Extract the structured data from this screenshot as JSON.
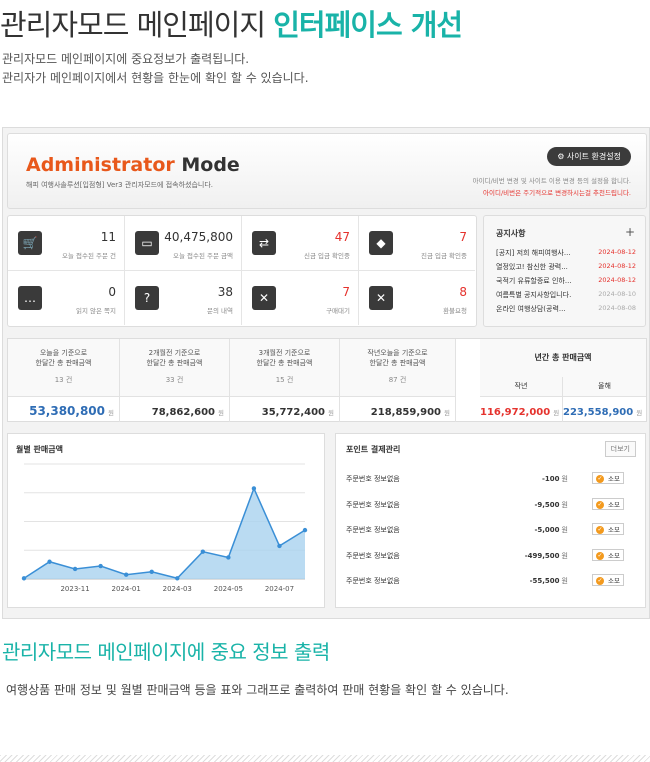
{
  "title": {
    "plain": "관리자모드 메인페이지 ",
    "highlight": "인터페이스 개선"
  },
  "intro": [
    "관리자모드 메인페이지에 중요정보가 출력됩니다.",
    "관리자가 메인페이지에서 현황을 한눈에 확인 할 수 있습니다."
  ],
  "header": {
    "logo_a": "Administrator",
    "logo_b": " Mode",
    "logo_sub": "해피 여행사솔루션[입점형] Ver3 관리자모드에 접속하셨습니다.",
    "site_settings": "⚙ 사이트 환경설정",
    "note1": "아이디/비번 변경 및 사이트 이용 변경 등의 설정을 합니다.",
    "note2": "아이디/비번은 주기적으로 변경하시는걸 추천드립니다."
  },
  "stats": [
    {
      "icon": "cart-icon",
      "glyph": "🛒",
      "value": "11",
      "label": "오늘 접수된 주문 건",
      "red": false
    },
    {
      "icon": "card-icon",
      "glyph": "▭",
      "value": "40,475,800",
      "label": "오늘 접수된 주문 금액",
      "red": false
    },
    {
      "icon": "deposit-icon",
      "glyph": "⇄",
      "value": "47",
      "label": "신금 입금 확인중",
      "red": true
    },
    {
      "icon": "cancel-icon",
      "glyph": "◆",
      "value": "7",
      "label": "진금 입금 확인중",
      "red": true
    },
    {
      "icon": "chat-icon",
      "glyph": "…",
      "value": "0",
      "label": "읽지 않은 쪽지",
      "red": false
    },
    {
      "icon": "question-icon",
      "glyph": "?",
      "value": "38",
      "label": "문의 내역",
      "red": false
    },
    {
      "icon": "cart-cancel-icon",
      "glyph": "✕",
      "value": "7",
      "label": "구매대기",
      "red": true
    },
    {
      "icon": "refund-icon",
      "glyph": "✕",
      "value": "8",
      "label": "환불요청",
      "red": true
    }
  ],
  "notice": {
    "title": "공지사항",
    "plus": "+",
    "items": [
      {
        "text": "[공지] 저희 해피여행사...",
        "date": "2024-08-12",
        "grey": false
      },
      {
        "text": "열정있고! 참신한 광력...",
        "date": "2024-08-12",
        "grey": false
      },
      {
        "text": "국적기 유류할증료 인하...",
        "date": "2024-08-12",
        "grey": false
      },
      {
        "text": "여름특별 공지사항입니다.",
        "date": "2024-08-10",
        "grey": true
      },
      {
        "text": "온라인 여행상담(공력...",
        "date": "2024-08-08",
        "grey": true
      }
    ]
  },
  "sales": {
    "columns": [
      {
        "p1": "오늘을 기준으로",
        "p2": "한달간 총 판매금액",
        "count": "13 건",
        "value": "53,380,800",
        "unit": "원"
      },
      {
        "p1": "2개월전 기준으로",
        "p2": "한달간 총 판매금액",
        "count": "33 건",
        "value": "78,862,600",
        "unit": "원"
      },
      {
        "p1": "3개월전 기준으로",
        "p2": "한달간 총 판매금액",
        "count": "15 건",
        "value": "35,772,400",
        "unit": "원"
      },
      {
        "p1": "작년오늘을 기준으로",
        "p2": "한달간 총 판매금액",
        "count": "87 건",
        "value": "218,859,900",
        "unit": "원"
      }
    ],
    "yearly_title": "년간 총 판매금액",
    "last_year_label": "작년",
    "this_year_label": "올해",
    "last_year_value": "116,972,000",
    "this_year_value": "223,558,900",
    "unit": "원"
  },
  "chart_data": {
    "type": "area",
    "title": "월별 판매금액",
    "x": [
      "2023-10",
      "2023-11",
      "2023-12",
      "2024-01",
      "2024-02",
      "2024-03",
      "2024-04",
      "2024-05",
      "2024-06",
      "2024-07",
      "2024-08"
    ],
    "tick_labels": [
      "2023-11",
      "2024-01",
      "2024-03",
      "2024-05",
      "2024-07"
    ],
    "values": [
      0.5,
      12,
      7,
      9,
      3,
      5,
      0.5,
      19,
      15,
      63,
      23,
      34
    ],
    "ylim": [
      0,
      80
    ],
    "grid": true,
    "colors": {
      "line": "#3a8fd6",
      "fill": "#a9d2ef"
    }
  },
  "points": {
    "title": "포인트 결제관리",
    "more": "더보기",
    "rows": [
      {
        "order": "주문번호 정보없음",
        "amount": "-100",
        "unit": "원",
        "btn": "소모"
      },
      {
        "order": "주문번호 정보없음",
        "amount": "-9,500",
        "unit": "원",
        "btn": "소모"
      },
      {
        "order": "주문번호 정보없음",
        "amount": "-5,000",
        "unit": "원",
        "btn": "소모"
      },
      {
        "order": "주문번호 정보없음",
        "amount": "-499,500",
        "unit": "원",
        "btn": "소모"
      },
      {
        "order": "주문번호 정보없음",
        "amount": "-55,500",
        "unit": "원",
        "btn": "소모"
      }
    ]
  },
  "section2": {
    "title": "관리자모드 메인페이지에 중요 정보 출력",
    "desc": "여행상품 판매 정보 및 월별 판매금액 등을 표와 그래프로 출력하여 판매 현황을 확인 할 수 있습니다."
  }
}
